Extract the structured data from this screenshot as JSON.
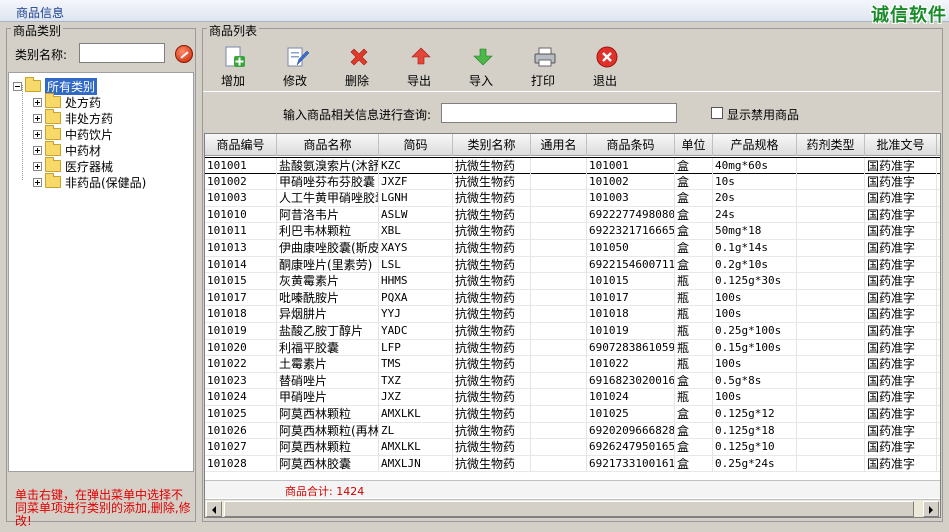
{
  "topbar": {
    "tab_label": "商品信息",
    "brand": "诚信软件"
  },
  "left": {
    "legend": "商品类别",
    "search_label": "类别名称:",
    "search_value": "",
    "tree_root": "所有类别",
    "tree_children": [
      "处方药",
      "非处方药",
      "中药饮片",
      "中药材",
      "医疗器械",
      "非药品(保健品)"
    ],
    "hint": "单击右键，在弹出菜单中选择不同菜单项进行类别的添加,删除,修改!"
  },
  "right": {
    "legend": "商品列表",
    "toolbar": {
      "add": "增加",
      "edit": "修改",
      "delete": "删除",
      "export": "导出",
      "import": "导入",
      "print": "打印",
      "exit": "退出"
    },
    "query_label": "输入商品相关信息进行查询:",
    "query_value": "",
    "checkbox_label": "显示禁用商品",
    "columns": [
      "商品编号",
      "商品名称",
      "简码",
      "类别名称",
      "通用名",
      "商品条码",
      "单位",
      "产品规格",
      "药剂类型",
      "批准文号"
    ],
    "rows": [
      [
        "101001",
        "盐酸氨溴索片(沐舒坦)",
        "KZC",
        "抗微生物药",
        "",
        "101001",
        "盒",
        "40mg*60s",
        "",
        "国药准字"
      ],
      [
        "101002",
        "甲硝唑芬布芬胶囊",
        "JXZF",
        "抗微生物药",
        "",
        "101002",
        "盒",
        "10s",
        "",
        "国药准字"
      ],
      [
        "101003",
        "人工牛黄甲硝唑胶囊",
        "LGNH",
        "抗微生物药",
        "",
        "101003",
        "盒",
        "20s",
        "",
        "国药准字"
      ],
      [
        "101010",
        "阿昔洛韦片",
        "ASLW",
        "抗微生物药",
        "",
        "6922277498080",
        "盒",
        "24s",
        "",
        "国药准字"
      ],
      [
        "101011",
        "利巴韦林颗粒",
        "XBL",
        "抗微生物药",
        "",
        "6922321716665",
        "盒",
        "50mg*18",
        "",
        "国药准字"
      ],
      [
        "101013",
        "伊曲康唑胶囊(斯皮仁诺)",
        "XAYS",
        "抗微生物药",
        "",
        "101050",
        "盒",
        "0.1g*14s",
        "",
        "国药准字"
      ],
      [
        "101014",
        "酮康唑片(里素劳)",
        "LSL",
        "抗微生物药",
        "",
        "6922154600711",
        "盒",
        "0.2g*10s",
        "",
        "国药准字"
      ],
      [
        "101015",
        "灰黄霉素片",
        "HHMS",
        "抗微生物药",
        "",
        "101015",
        "瓶",
        "0.125g*30s",
        "",
        "国药准字"
      ],
      [
        "101017",
        "吡嗪酰胺片",
        "PQXA",
        "抗微生物药",
        "",
        "101017",
        "瓶",
        "100s",
        "",
        "国药准字"
      ],
      [
        "101018",
        "异烟肼片",
        "YYJ",
        "抗微生物药",
        "",
        "101018",
        "瓶",
        "100s",
        "",
        "国药准字"
      ],
      [
        "101019",
        "盐酸乙胺丁醇片",
        "YADC",
        "抗微生物药",
        "",
        "101019",
        "瓶",
        "0.25g*100s",
        "",
        "国药准字"
      ],
      [
        "101020",
        "利福平胶囊",
        "LFP",
        "抗微生物药",
        "",
        "6907283861059",
        "瓶",
        "0.15g*100s",
        "",
        "国药准字"
      ],
      [
        "101022",
        "土霉素片",
        "TMS",
        "抗微生物药",
        "",
        "101022",
        "瓶",
        "100s",
        "",
        "国药准字"
      ],
      [
        "101023",
        "替硝唑片",
        "TXZ",
        "抗微生物药",
        "",
        "6916823020016",
        "盒",
        "0.5g*8s",
        "",
        "国药准字"
      ],
      [
        "101024",
        "甲硝唑片",
        "JXZ",
        "抗微生物药",
        "",
        "101024",
        "瓶",
        "100s",
        "",
        "国药准字"
      ],
      [
        "101025",
        "阿莫西林颗粒",
        "AMXLKL",
        "抗微生物药",
        "",
        "101025",
        "盒",
        "0.125g*12",
        "",
        "国药准字"
      ],
      [
        "101026",
        "阿莫西林颗粒(再林)",
        "ZL",
        "抗微生物药",
        "",
        "6920209666828",
        "盒",
        "0.125g*18",
        "",
        "国药准字"
      ],
      [
        "101027",
        "阿莫西林颗粒",
        "AMXLKL",
        "抗微生物药",
        "",
        "6926247950165",
        "盒",
        "0.125g*10",
        "",
        "国药准字"
      ],
      [
        "101028",
        "阿莫西林胶囊",
        "AMXLJN",
        "抗微生物药",
        "",
        "6921733100161",
        "盒",
        "0.25g*24s",
        "",
        "国药准字"
      ]
    ],
    "total": "商品合计: 1424"
  },
  "colors": {
    "hint_red": "#e00000",
    "brand_green": "#1a8a2a",
    "selection": "#316ac5"
  }
}
